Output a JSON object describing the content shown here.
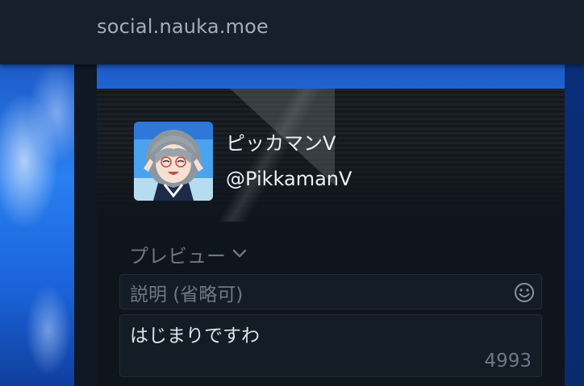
{
  "header": {
    "site_title": "social.nauka.moe"
  },
  "profile": {
    "display_name": "ピッカマンV",
    "handle": "@PikkamanV",
    "avatar_alt": "avatar"
  },
  "compose": {
    "preview_label": "プレビュー",
    "description_placeholder": "説明 (省略可)",
    "post_text": "はじまりですわ",
    "char_count": "4993",
    "emoji_icon": "smiley-icon",
    "preview_icon": "chevron-down-icon"
  },
  "colors": {
    "topbar": "#161f2b",
    "panel": "#0f151d",
    "text_primary": "#ecf0f4",
    "text_muted": "#6e7885"
  }
}
